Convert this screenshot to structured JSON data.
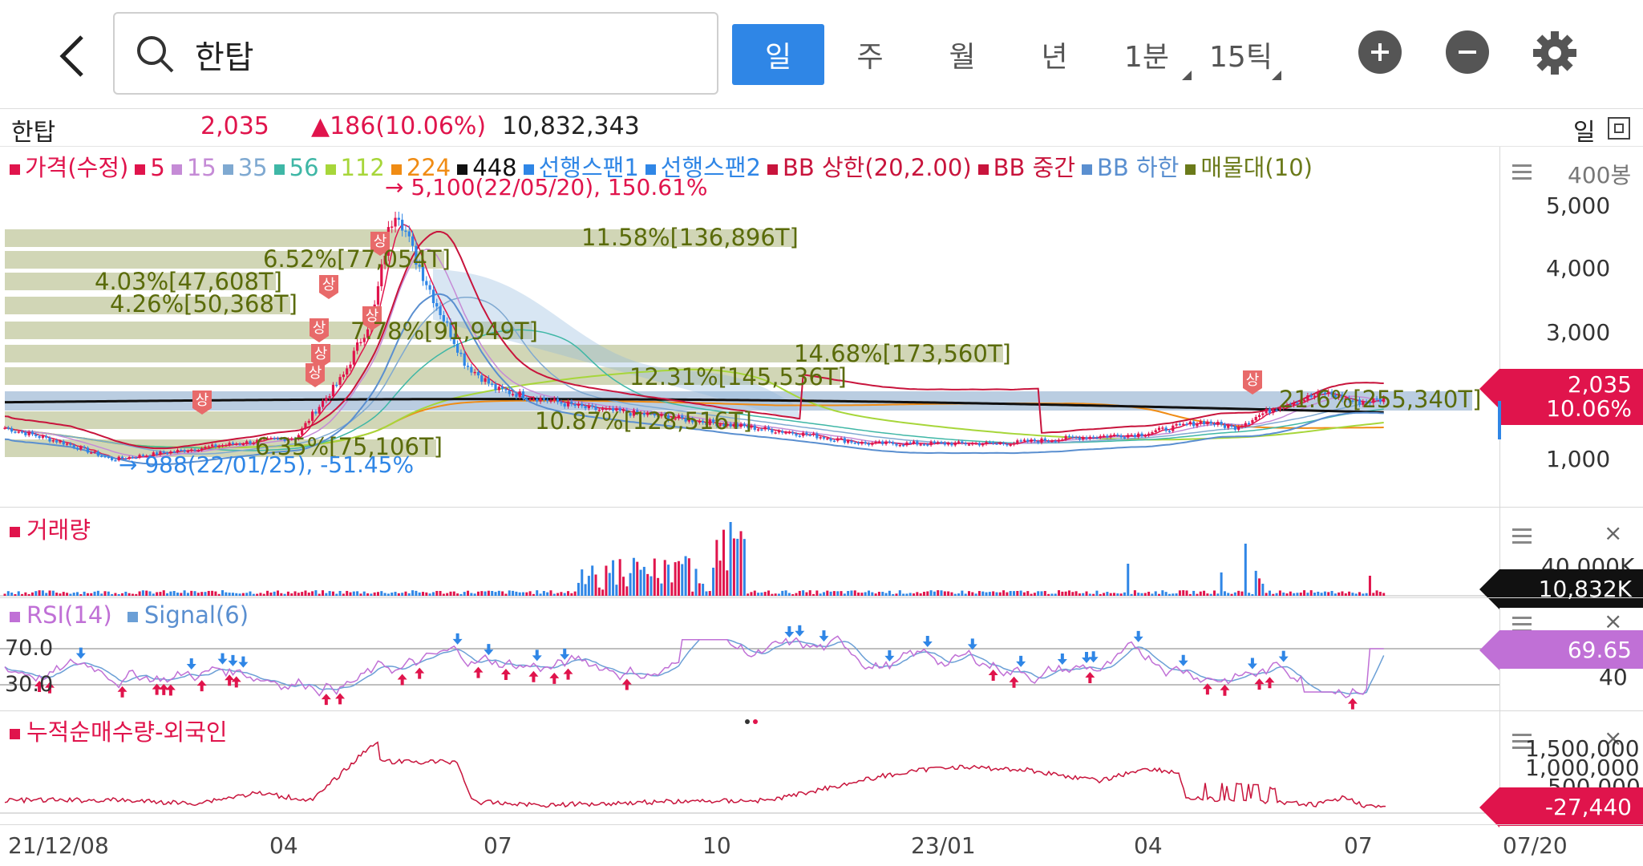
{
  "header": {
    "search_value": "한탑",
    "periods": [
      "일",
      "주",
      "월",
      "년",
      "1분",
      "15틱"
    ]
  },
  "info": {
    "name": "한탑",
    "price": "2,035",
    "change": "▲186(10.06%)",
    "volume": "10,832,343",
    "period_label": "일"
  },
  "legend": [
    {
      "label": "가격(수정)",
      "color": "#e0144c"
    },
    {
      "label": "5",
      "color": "#e0144c"
    },
    {
      "label": "15",
      "color": "#c58bd6"
    },
    {
      "label": "35",
      "color": "#7fa9d1"
    },
    {
      "label": "56",
      "color": "#3fb7a6"
    },
    {
      "label": "112",
      "color": "#a7d63a"
    },
    {
      "label": "224",
      "color": "#f08c14"
    },
    {
      "label": "448",
      "color": "#111111"
    },
    {
      "label": "선행스팬1",
      "color": "#2f86e6"
    },
    {
      "label": "선행스팬2",
      "color": "#2f86e6"
    },
    {
      "label": "BB 상한(20,2.00)",
      "color": "#c8143c"
    },
    {
      "label": "BB 중간",
      "color": "#c8143c"
    },
    {
      "label": "BB 하한",
      "color": "#5a8fd0"
    },
    {
      "label": "매물대(10)",
      "color": "#6b7a1a"
    }
  ],
  "price_panel": {
    "unit_label": "400봉",
    "y_labels": [
      "5,000",
      "4,000",
      "3,000",
      "1,000"
    ],
    "high_note": "→ 5,100(22/05/20), 150.61%",
    "low_note": "→ 988(22/01/25), -51.45%",
    "volume_profile": [
      "11.58%[136,896T]",
      "6.52%[77,054T]",
      "4.03%[47,608T]",
      "4.26%[50,368T]",
      "7.78%[91,949T]",
      "14.68%[173,560T]",
      "12.31%[145,536T]",
      "21.6%[255,340T]",
      "10.87%[128,516T]",
      "6.35%[75,106T]"
    ],
    "limit_badge": "상",
    "current_price": "2,035",
    "current_change": "10.06%",
    "colors": {
      "up": "#e0144c",
      "down": "#2f86e6",
      "profile": "#c9cfa9",
      "profile_text": "#5a6b0a"
    }
  },
  "volume_panel": {
    "title": "거래량",
    "y_label": "40,000K",
    "current": "10,832K"
  },
  "rsi_panel": {
    "title_rsi": "RSI(14)",
    "title_signal": "Signal(6)",
    "level_high": "70.0",
    "level_low": "30.0",
    "right_label": "40",
    "current": "69.65"
  },
  "foreign_panel": {
    "title": "누적순매수량-외국인",
    "y_labels": [
      "1,500,000",
      "1,000,000",
      "500,000"
    ],
    "current": "-27,440"
  },
  "x_axis": [
    "21/12/08",
    "04",
    "07",
    "10",
    "23/01",
    "04",
    "07",
    "07/20"
  ]
}
